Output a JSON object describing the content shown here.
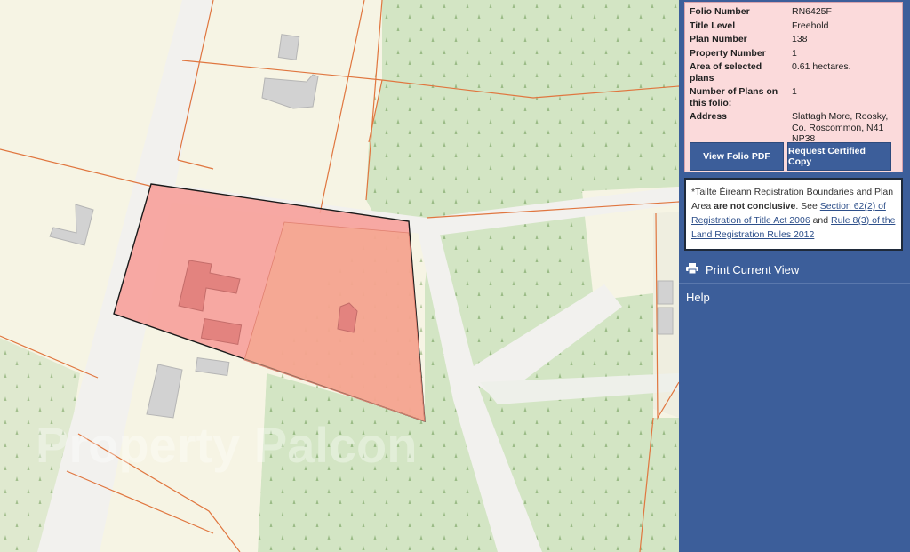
{
  "folio": {
    "rows": [
      {
        "label": "Folio Number",
        "value": "RN6425F"
      },
      {
        "label": "Title Level",
        "value": "Freehold"
      },
      {
        "label": "Plan Number",
        "value": "138"
      },
      {
        "label": "Property Number",
        "value": "1"
      },
      {
        "label": "Area of selected plans",
        "value": "0.61 hectares."
      },
      {
        "label": "Number of Plans on this folio:",
        "value": "1"
      },
      {
        "label": "Address",
        "value": "Slattagh More, Roosky, Co. Roscommon, N41 NP38"
      }
    ],
    "view_pdf_label": "View Folio PDF",
    "request_copy_label": "Request Certified Copy"
  },
  "disclaimer": {
    "prefix": "*Tailte Éireann Registration Boundaries and Plan Area ",
    "bold": "are not conclusive",
    "middle": ". See ",
    "link1": "Section 62(2) of Registration of Title Act 2006",
    "and": " and ",
    "link2": "Rule 8(3) of the Land Registration Rules 2012"
  },
  "menu": {
    "print_label": "Print Current View",
    "help_label": "Help"
  },
  "map": {
    "watermark": "Property Palcon"
  },
  "colors": {
    "panel": "#3c5e9a",
    "info_bg": "#fbdadb",
    "parcel_fill": "#f7a09a",
    "forest": "#d3e5c4",
    "land": "#f6f4e4",
    "boundary": "#e0763f"
  }
}
